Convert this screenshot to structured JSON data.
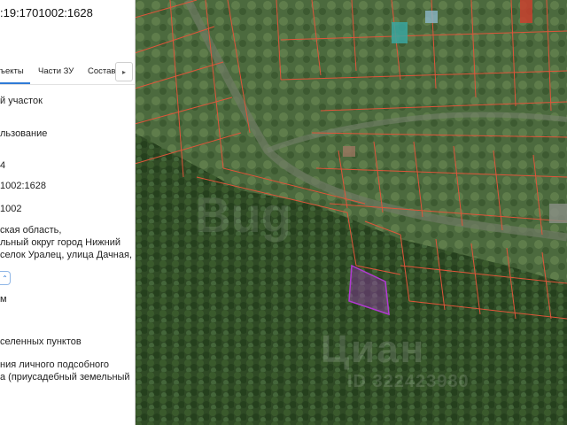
{
  "panel": {
    "cadastral_number": ":19:1701002:1628",
    "tabs": [
      "ъекты",
      "Части ЗУ",
      "Состав"
    ],
    "tabs_next_icon": "chevron-right-icon",
    "lines": [
      "й участок",
      "льзование",
      "4",
      "1002:1628",
      "1002",
      "ская область,",
      "льный округ город Нижний",
      "селок Уралец, улица Дачная,",
      "м",
      "селенных пунктов",
      "ния личного подсобного",
      "а (приусадебный земельный"
    ],
    "collapse_icon": "chevron-up-icon"
  },
  "map": {
    "parcel_line_color": "#e0553a",
    "highlight_color": "#b23ad2",
    "watermark_text": "Циан",
    "watermark_id": "ID 322423980",
    "watermark_logo": "Bug"
  }
}
